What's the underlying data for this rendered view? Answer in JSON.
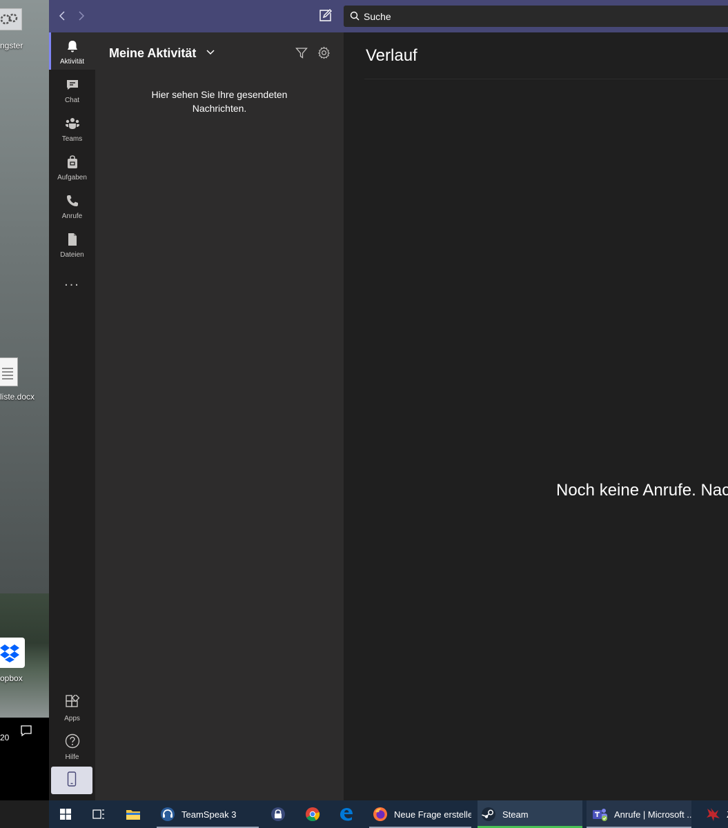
{
  "desktop": {
    "icon1_label": "ngster",
    "doc_label": "liste.docx",
    "dropbox_label": "opbox",
    "clock_fragment": "20"
  },
  "titlebar": {
    "back_icon": "chevron-left-icon",
    "forward_icon": "chevron-right-icon",
    "compose_icon": "compose-icon",
    "search_placeholder": "Suche"
  },
  "rail": {
    "items": [
      {
        "label": "Aktivität",
        "icon": "bell-icon"
      },
      {
        "label": "Chat",
        "icon": "chat-icon"
      },
      {
        "label": "Teams",
        "icon": "teams-icon"
      },
      {
        "label": "Aufgaben",
        "icon": "tasks-bag-icon"
      },
      {
        "label": "Anrufe",
        "icon": "phone-icon"
      },
      {
        "label": "Dateien",
        "icon": "file-icon"
      }
    ],
    "more": "...",
    "apps_label": "Apps",
    "help_label": "Hilfe"
  },
  "activity_panel": {
    "title": "Meine Aktivität",
    "empty_text": "Hier sehen Sie Ihre gesendeten Nachrichten."
  },
  "main": {
    "title": "Verlauf",
    "empty_text": "Noch keine Anrufe. Nac"
  },
  "taskbar": {
    "items": [
      {
        "label": "TeamSpeak 3"
      },
      {
        "label": "Neue Frage erstelle..."
      },
      {
        "label": "Steam"
      },
      {
        "label": "Anrufe | Microsoft ..."
      },
      {
        "label": "Z"
      }
    ]
  },
  "colors": {
    "titlebar": "#464775",
    "rail": "#201f1f",
    "panel": "#2d2c2c",
    "main": "#1f1f1f",
    "accent": "#7f85f5",
    "steam_underline": "#49c255"
  }
}
